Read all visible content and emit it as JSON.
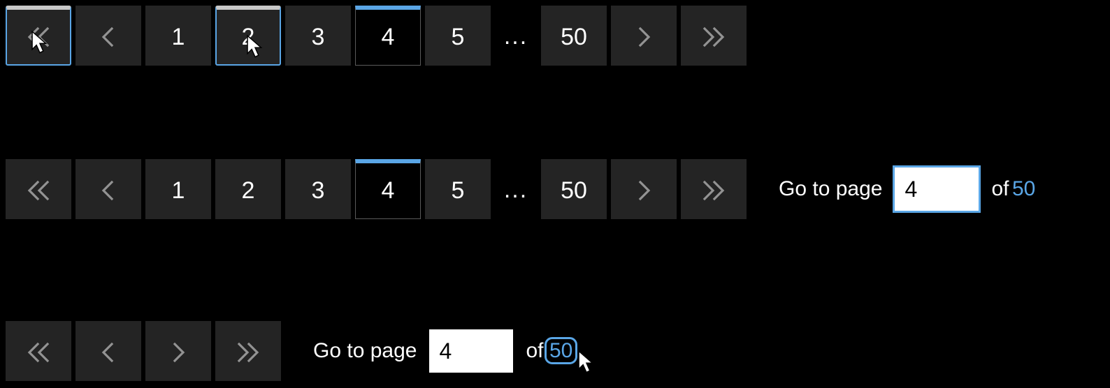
{
  "row1": {
    "pages": [
      "1",
      "2",
      "3",
      "4",
      "5"
    ],
    "ellipsis": "...",
    "last": "50",
    "current_index": 3,
    "focused": [
      0,
      2
    ]
  },
  "row2": {
    "pages": [
      "1",
      "2",
      "3",
      "4",
      "5"
    ],
    "ellipsis": "...",
    "last": "50",
    "current_index": 3,
    "goto_label": "Go to page",
    "goto_value": "4",
    "of_label": "of",
    "total": "50",
    "input_focused": true
  },
  "row3": {
    "goto_label": "Go to page",
    "goto_value": "4",
    "of_label": "of",
    "total": "50",
    "total_focused": true
  }
}
